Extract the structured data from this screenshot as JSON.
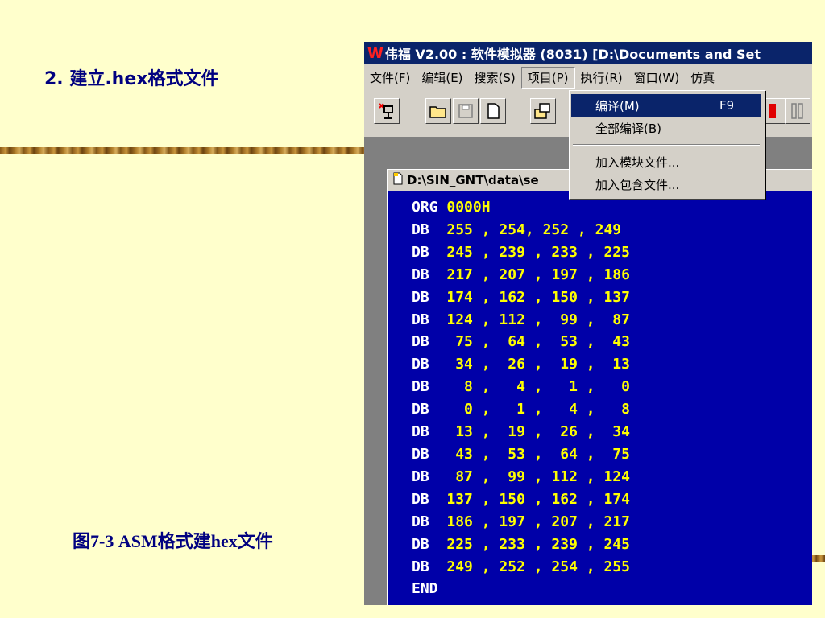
{
  "slide": {
    "heading": "2. 建立.hex格式文件",
    "caption": "图7-3  ASM格式建hex文件"
  },
  "app": {
    "logo": "W",
    "title": "伟福 V2.00 : 软件模拟器 (8031) [D:\\Documents and Set",
    "menu": [
      "文件(F)",
      "编辑(E)",
      "搜索(S)",
      "项目(P)",
      "执行(R)",
      "窗口(W)",
      "仿真"
    ],
    "active_menu": "项目(P)"
  },
  "dropdown": {
    "items": [
      {
        "label": "编译(M)",
        "shortcut": "F9"
      },
      {
        "label": "全部编译(B)",
        "shortcut": ""
      },
      {
        "label": "加入模块文件...",
        "shortcut": ""
      },
      {
        "label": "加入包含文件...",
        "shortcut": ""
      }
    ]
  },
  "document": {
    "title": "D:\\SIN_GNT\\data\\se",
    "lines": [
      {
        "op": "ORG",
        "args": "0000H"
      },
      {
        "op": "DB",
        "args": "255 , 254, 252 , 249"
      },
      {
        "op": "DB",
        "args": "245 , 239 , 233 , 225"
      },
      {
        "op": "DB",
        "args": "217 , 207 , 197 , 186"
      },
      {
        "op": "DB",
        "args": "174 , 162 , 150 , 137"
      },
      {
        "op": "DB",
        "args": "124 , 112 ,  99 ,  87"
      },
      {
        "op": "DB",
        "args": " 75 ,  64 ,  53 ,  43"
      },
      {
        "op": "DB",
        "args": " 34 ,  26 ,  19 ,  13"
      },
      {
        "op": "DB",
        "args": "  8 ,   4 ,   1 ,   0"
      },
      {
        "op": "DB",
        "args": "  0 ,   1 ,   4 ,   8"
      },
      {
        "op": "DB",
        "args": " 13 ,  19 ,  26 ,  34"
      },
      {
        "op": "DB",
        "args": " 43 ,  53 ,  64 ,  75"
      },
      {
        "op": "DB",
        "args": " 87 ,  99 , 112 , 124"
      },
      {
        "op": "DB",
        "args": "137 , 150 , 162 , 174"
      },
      {
        "op": "DB",
        "args": "186 , 197 , 207 , 217"
      },
      {
        "op": "DB",
        "args": "225 , 233 , 239 , 245"
      },
      {
        "op": "DB",
        "args": "249 , 252 , 254 , 255"
      },
      {
        "op": "END",
        "args": ""
      }
    ]
  },
  "icons": [
    "close-file-icon",
    "open-folder-icon",
    "save-icon",
    "new-file-icon",
    "open-project-icon",
    "stop-icon",
    "pause-icon",
    "document-icon"
  ],
  "colors": {
    "slide_bg": "#FFFFCC",
    "heading": "#000080",
    "titlebar": "#0a246a",
    "editor_bg": "#0000a8",
    "code_text": "#ffff00",
    "keyword": "#ffffff"
  }
}
